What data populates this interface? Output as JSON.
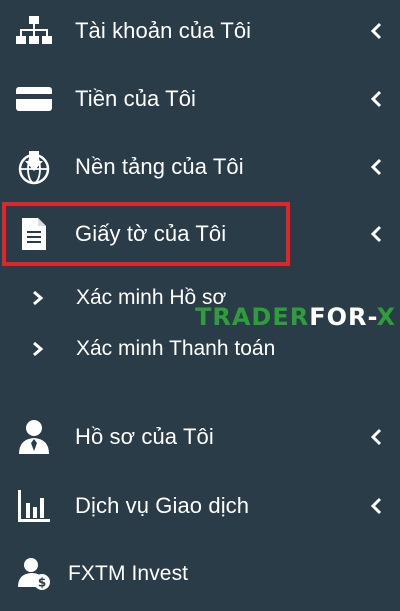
{
  "menu": {
    "items": [
      {
        "label": "Tài khoản của Tôi",
        "icon": "sitemap-icon"
      },
      {
        "label": "Tiền của Tôi",
        "icon": "credit-card-icon"
      },
      {
        "label": "Nền tảng của Tôi",
        "icon": "globe-download-icon"
      },
      {
        "label": "Giấy tờ của Tôi",
        "icon": "document-icon"
      },
      {
        "label": "Hồ sơ của Tôi",
        "icon": "user-tie-icon"
      },
      {
        "label": "Dịch vụ Giao dịch",
        "icon": "bar-chart-icon"
      },
      {
        "label": "FXTM Invest",
        "icon": "user-dollar-icon"
      }
    ],
    "subitems": [
      {
        "label": "Xác minh Hồ sơ"
      },
      {
        "label": "Xác minh Thanh toán"
      }
    ]
  },
  "watermark": {
    "part1": "TRADER",
    "part2": "FOR",
    "part3": "-",
    "part4": "X"
  },
  "colors": {
    "background": "#2a3c47",
    "highlight": "#e0262a",
    "watermark_green": "#2e9d3a"
  }
}
